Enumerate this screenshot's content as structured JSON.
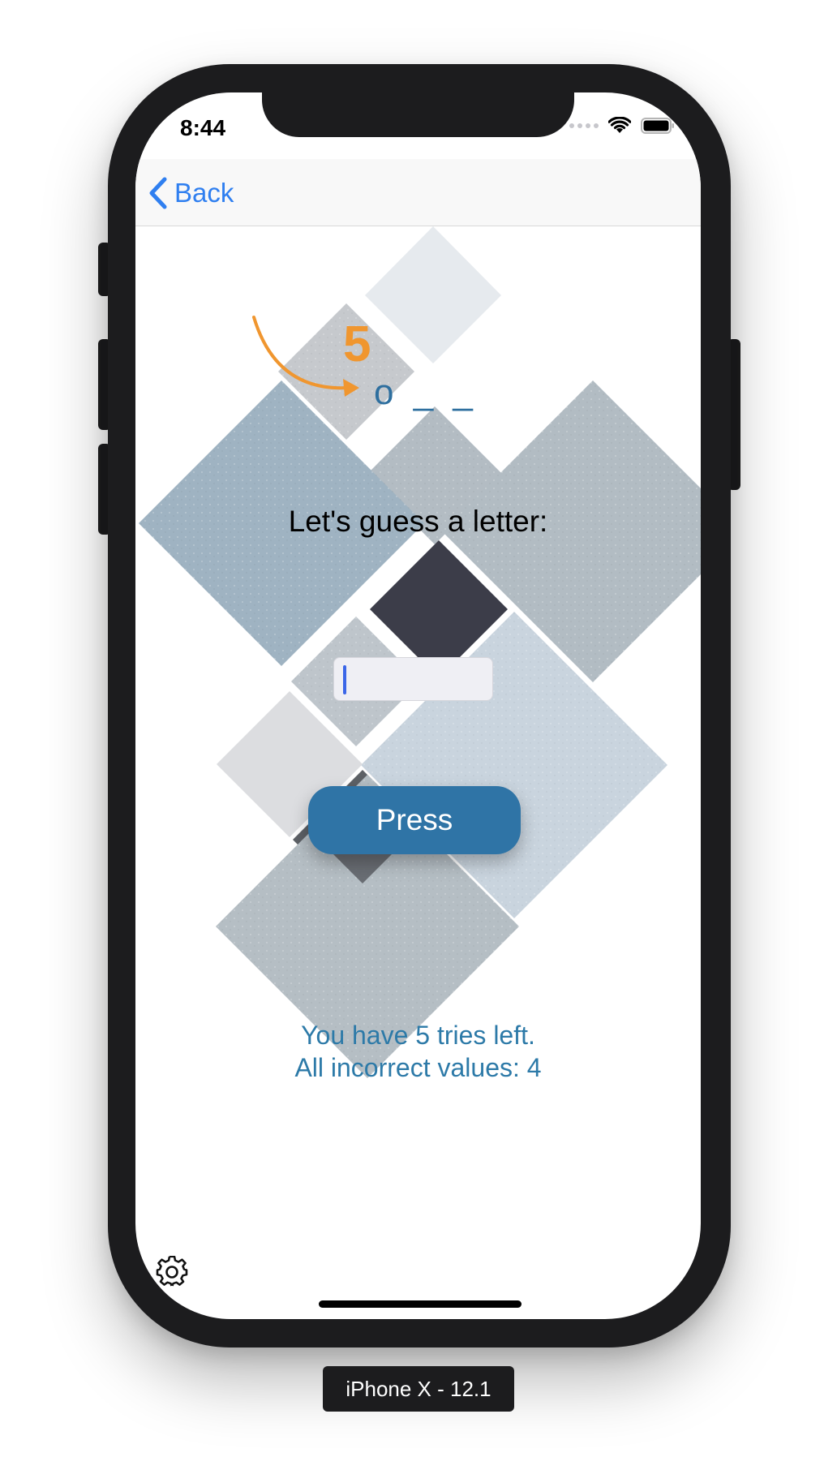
{
  "status": {
    "time": "8:44"
  },
  "nav": {
    "back_label": "Back"
  },
  "game": {
    "hint_number": "5",
    "word": "o _ _",
    "prompt": "Let's guess a letter:",
    "input_value": "",
    "press_label": "Press",
    "tries_text": "You have 5 tries left.",
    "incorrect_text": "All incorrect values: 4"
  },
  "device": {
    "label": "iPhone X - 12.1"
  },
  "icons": {
    "back": "chevron-left-icon",
    "settings": "gear-icon",
    "wifi": "wifi-icon",
    "battery": "battery-icon",
    "signal": "signal-icon"
  },
  "colors": {
    "accent_blue": "#2f7ff0",
    "button_blue": "#2f74a6",
    "text_blue": "#2d7aa8",
    "hint_orange": "#f0962f"
  }
}
